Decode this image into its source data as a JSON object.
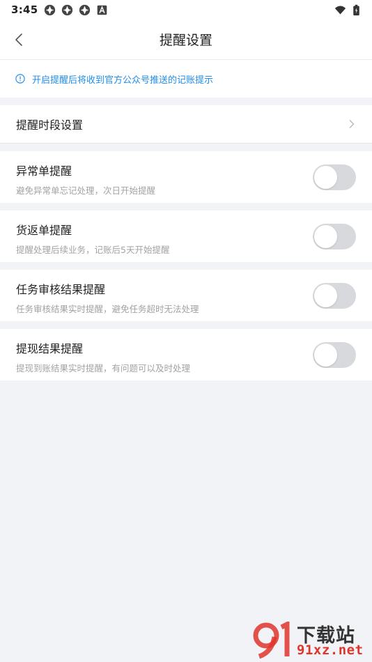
{
  "status_bar": {
    "time": "3:45",
    "icons": [
      "app-notification-icon",
      "app-notification-icon",
      "app-notification-icon",
      "a-badge-icon"
    ],
    "right_icons": [
      "wifi-icon",
      "battery-charging-icon"
    ]
  },
  "header": {
    "title": "提醒设置",
    "back_icon": "chevron-left-icon"
  },
  "notice": {
    "icon": "info-circle-icon",
    "text": "开启提醒后将收到官方公众号推送的记账提示",
    "color": "#1f8ded"
  },
  "time_setting": {
    "label": "提醒时段设置",
    "icon": "chevron-right-icon"
  },
  "reminders": [
    {
      "name": "异常单提醒",
      "desc": "避免异常单忘记处理，次日开始提醒",
      "enabled": false
    },
    {
      "name": "货返单提醒",
      "desc": "提醒处理后续业务，记账后5天开始提醒",
      "enabled": false
    },
    {
      "name": "任务审核结果提醒",
      "desc": "任务审核结果实时提醒，避免任务超时无法处理",
      "enabled": false
    },
    {
      "name": "提现结果提醒",
      "desc": "提现到账结果实时提醒，有问题可以及时处理",
      "enabled": false
    }
  ],
  "watermark": {
    "title": "下载站",
    "url": "91xz.net"
  },
  "colors": {
    "toggle_off": "#d8d9dd",
    "background": "#f2f3f7",
    "watermark_red": "#e0352b"
  }
}
